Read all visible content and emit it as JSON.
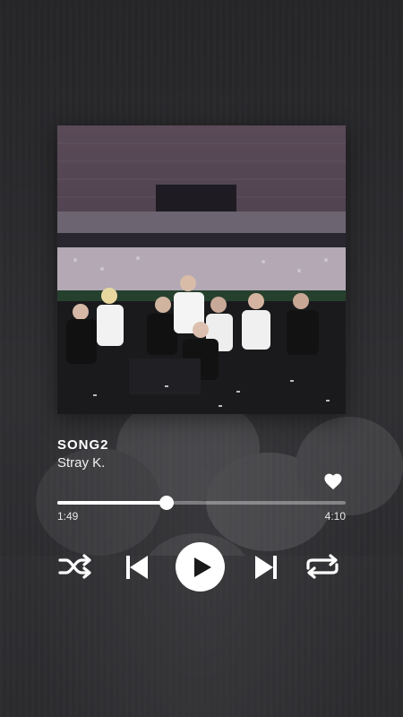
{
  "track": {
    "title": "SONG2",
    "artist": "Stray K."
  },
  "player": {
    "current_time": "1:49",
    "total_time": "4:10",
    "progress": 0.38,
    "liked": true
  },
  "controls": {
    "shuffle_icon": "shuffle-icon",
    "previous_icon": "skip-previous-icon",
    "play_icon": "play-icon",
    "next_icon": "skip-next-icon",
    "repeat_icon": "repeat-icon",
    "like_icon": "heart-icon"
  },
  "colors": {
    "foreground": "#ffffff",
    "background": "#3a3a3c"
  }
}
